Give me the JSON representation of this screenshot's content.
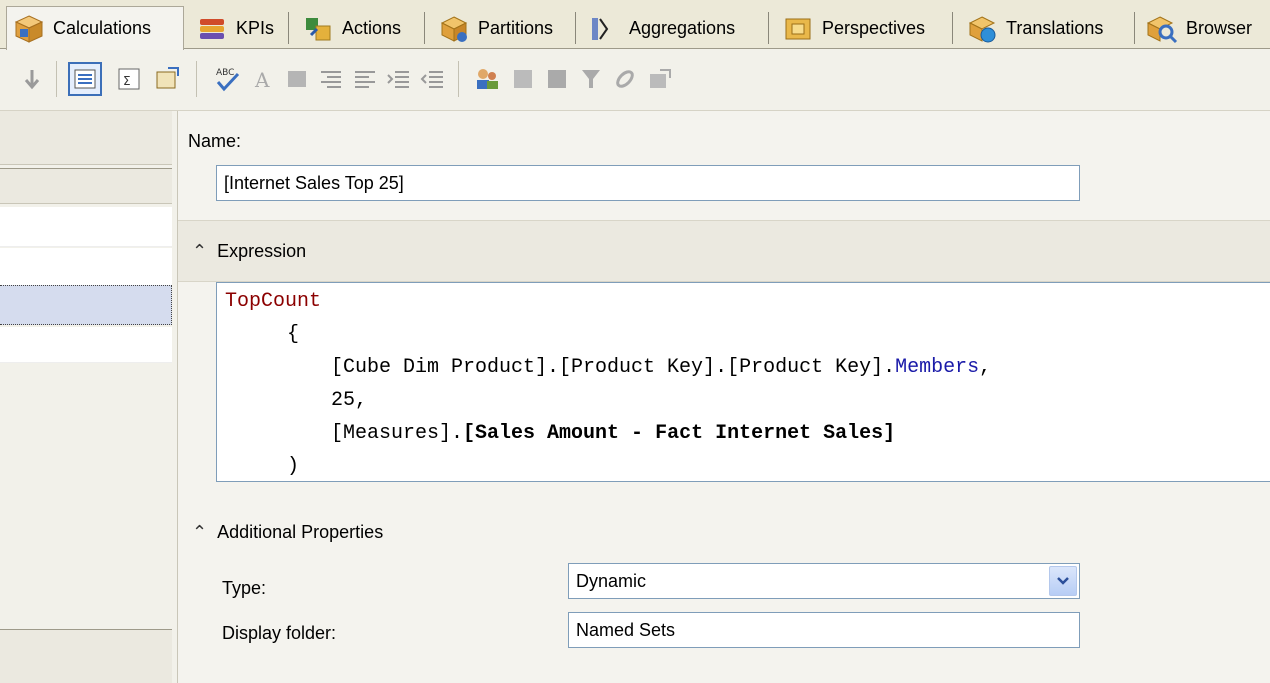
{
  "tabs": [
    {
      "label": "Calculations",
      "icon": "cube-icon",
      "active": true
    },
    {
      "label": "KPIs",
      "icon": "kpi-icon",
      "active": false
    },
    {
      "label": "Actions",
      "icon": "actions-icon",
      "active": false
    },
    {
      "label": "Partitions",
      "icon": "partitions-icon",
      "active": false
    },
    {
      "label": "Aggregations",
      "icon": "aggregations-icon",
      "active": false
    },
    {
      "label": "Perspectives",
      "icon": "perspectives-icon",
      "active": false
    },
    {
      "label": "Translations",
      "icon": "translations-icon",
      "active": false
    },
    {
      "label": "Browser",
      "icon": "browser-icon",
      "active": false
    }
  ],
  "form": {
    "name_label": "Name:",
    "name_value": "[Internet Sales Top 25]",
    "expression_label": "Expression",
    "expression": {
      "line1": "TopCount",
      "line2": "{",
      "line3a": "[Cube Dim Product].[Product Key].[Product Key].",
      "line3b": "Members",
      "line3c": ",",
      "line4": "25,",
      "line5a": "[Measures].",
      "line5b": "[Sales Amount - Fact Internet Sales]",
      "line6": ")"
    },
    "additional_label": "Additional Properties",
    "type_label": "Type:",
    "type_value": "Dynamic",
    "folder_label": "Display folder:",
    "folder_value": "Named Sets"
  },
  "colors": {
    "accent": "#3c6fb8",
    "keyword": "#8b0000",
    "function": "#1a1aa8"
  }
}
